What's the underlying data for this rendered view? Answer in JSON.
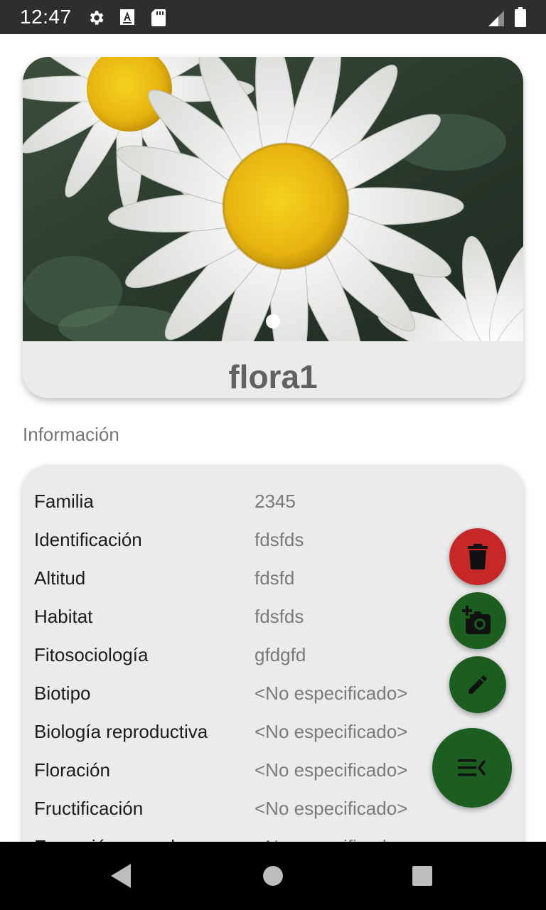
{
  "status_bar": {
    "time": "12:47",
    "icons": [
      "gear-icon",
      "text-a-icon",
      "sd-card-icon",
      "signal-icon",
      "battery-icon"
    ]
  },
  "specimen": {
    "title": "flora1",
    "image": "daisy-photo",
    "pager_count": 1
  },
  "info": {
    "section_label": "Información",
    "rows": [
      {
        "key": "Familia",
        "value": "2345"
      },
      {
        "key": "Identificación",
        "value": "fdsfds"
      },
      {
        "key": "Altitud",
        "value": "fdsfd"
      },
      {
        "key": "Habitat",
        "value": "fdsfds"
      },
      {
        "key": "Fitosociología",
        "value": "gfdgfd"
      },
      {
        "key": "Biotipo",
        "value": "<No especificado>"
      },
      {
        "key": "Biología reproductiva",
        "value": "<No especificado>"
      },
      {
        "key": "Floración",
        "value": "<No especificado>"
      },
      {
        "key": "Fructificación",
        "value": "<No especificado>"
      },
      {
        "key": "Expresión sexual",
        "value": "<No especificado>"
      }
    ]
  },
  "fabs": {
    "delete_icon": "trash-icon",
    "camera_icon": "add-photo-icon",
    "edit_icon": "pencil-icon",
    "main_icon": "menu-collapse-icon",
    "colors": {
      "delete": "#c62828",
      "primary": "#1b5e20"
    }
  },
  "nav_bar": {
    "icons": [
      "back-icon",
      "home-icon",
      "recents-icon"
    ]
  }
}
